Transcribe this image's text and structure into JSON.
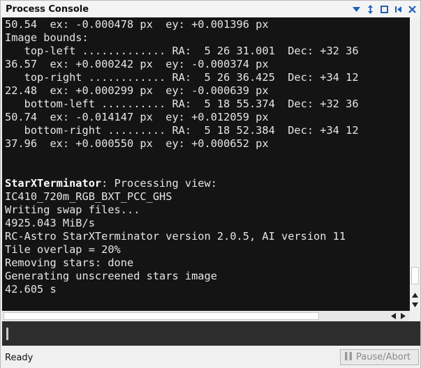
{
  "window": {
    "title": "Process Console"
  },
  "titlebar_icons": [
    "arrow-down-icon",
    "move-icon",
    "maximize-icon",
    "previous-icon",
    "close-icon"
  ],
  "console": {
    "lines": [
      {
        "text": "50.54  ex: -0.000478 px  ey: +0.001396 px"
      },
      {
        "text": "Image bounds:"
      },
      {
        "text": "   top-left ............. RA:  5 26 31.001  Dec: +32 36"
      },
      {
        "text": "36.57  ex: +0.000242 px  ey: -0.000374 px"
      },
      {
        "text": "   top-right ............ RA:  5 26 36.425  Dec: +34 12"
      },
      {
        "text": "22.48  ex: +0.000299 px  ey: -0.000639 px"
      },
      {
        "text": "   bottom-left .......... RA:  5 18 55.374  Dec: +32 36"
      },
      {
        "text": "50.74  ex: -0.014147 px  ey: +0.012059 px"
      },
      {
        "text": "   bottom-right ......... RA:  5 18 52.384  Dec: +34 12"
      },
      {
        "text": "37.96  ex: +0.000550 px  ey: +0.000652 px"
      },
      {
        "text": ""
      },
      {
        "text": ""
      },
      {
        "bold": "StarXTerminator",
        "text": ": Processing view:"
      },
      {
        "text": "IC410_720m_RGB_BXT_PCC_GHS"
      },
      {
        "text": "Writing swap files..."
      },
      {
        "text": "4925.043 MiB/s"
      },
      {
        "text": "RC-Astro StarXTerminator version 2.0.5, AI version 11"
      },
      {
        "text": "Tile overlap = 20%"
      },
      {
        "text": "Removing stars: done"
      },
      {
        "text": "Generating unscreened stars image"
      },
      {
        "text": "42.605 s"
      }
    ]
  },
  "command_input": {
    "value": "",
    "placeholder": ""
  },
  "statusbar": {
    "status": "Ready",
    "pause_abort_label": "Pause/Abort",
    "pause_abort_enabled": false
  },
  "colors": {
    "console_background": "#141414",
    "console_text": "#e6e6e6",
    "input_background": "#2d2d2d",
    "titlebar_icon": "#1c5fb8"
  }
}
